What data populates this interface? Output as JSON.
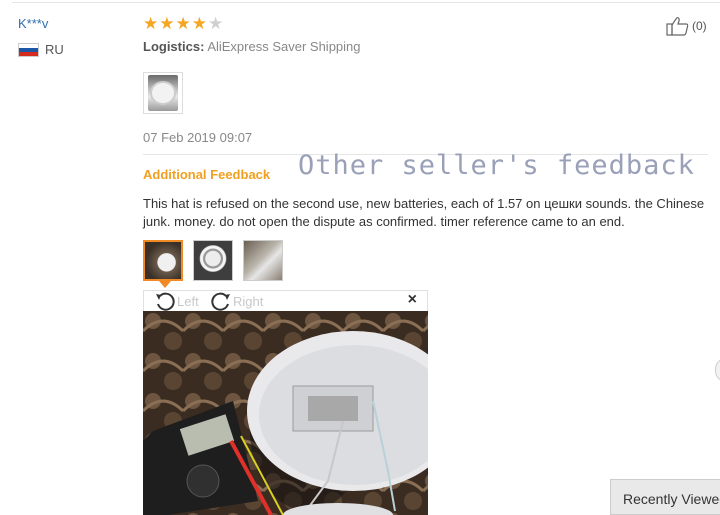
{
  "review": {
    "user": "K***v",
    "country": "RU",
    "rating": 4,
    "rating_max": 5,
    "likes": "(0)",
    "logistics_label": "Logistics:",
    "logistics_value": "AliExpress Saver Shipping",
    "date": "07 Feb 2019 09:07"
  },
  "additional": {
    "heading": "Additional Feedback",
    "watermark": "Other seller's feedback",
    "text": "This hat is refused on the second use, new batteries, each of 1.57 on цешки sounds. the Chinese junk. money. do not open the dispute as confirmed. timer reference came to an end."
  },
  "viewer": {
    "rotate_left": "Left",
    "rotate_right": "Right",
    "close": "×"
  },
  "footer": {
    "recently_viewed": "Recently Viewed"
  },
  "icons": {
    "star": "star-icon",
    "thumbs_up": "thumbs-up-icon",
    "flag": "russia-flag-icon",
    "rotate_left": "rotate-left-icon",
    "rotate_right": "rotate-right-icon",
    "close": "close-icon"
  },
  "colors": {
    "star_on": "#f5a623",
    "star_off": "#d0d0d0",
    "accent": "#f08a24",
    "link": "#2f6fb0"
  }
}
